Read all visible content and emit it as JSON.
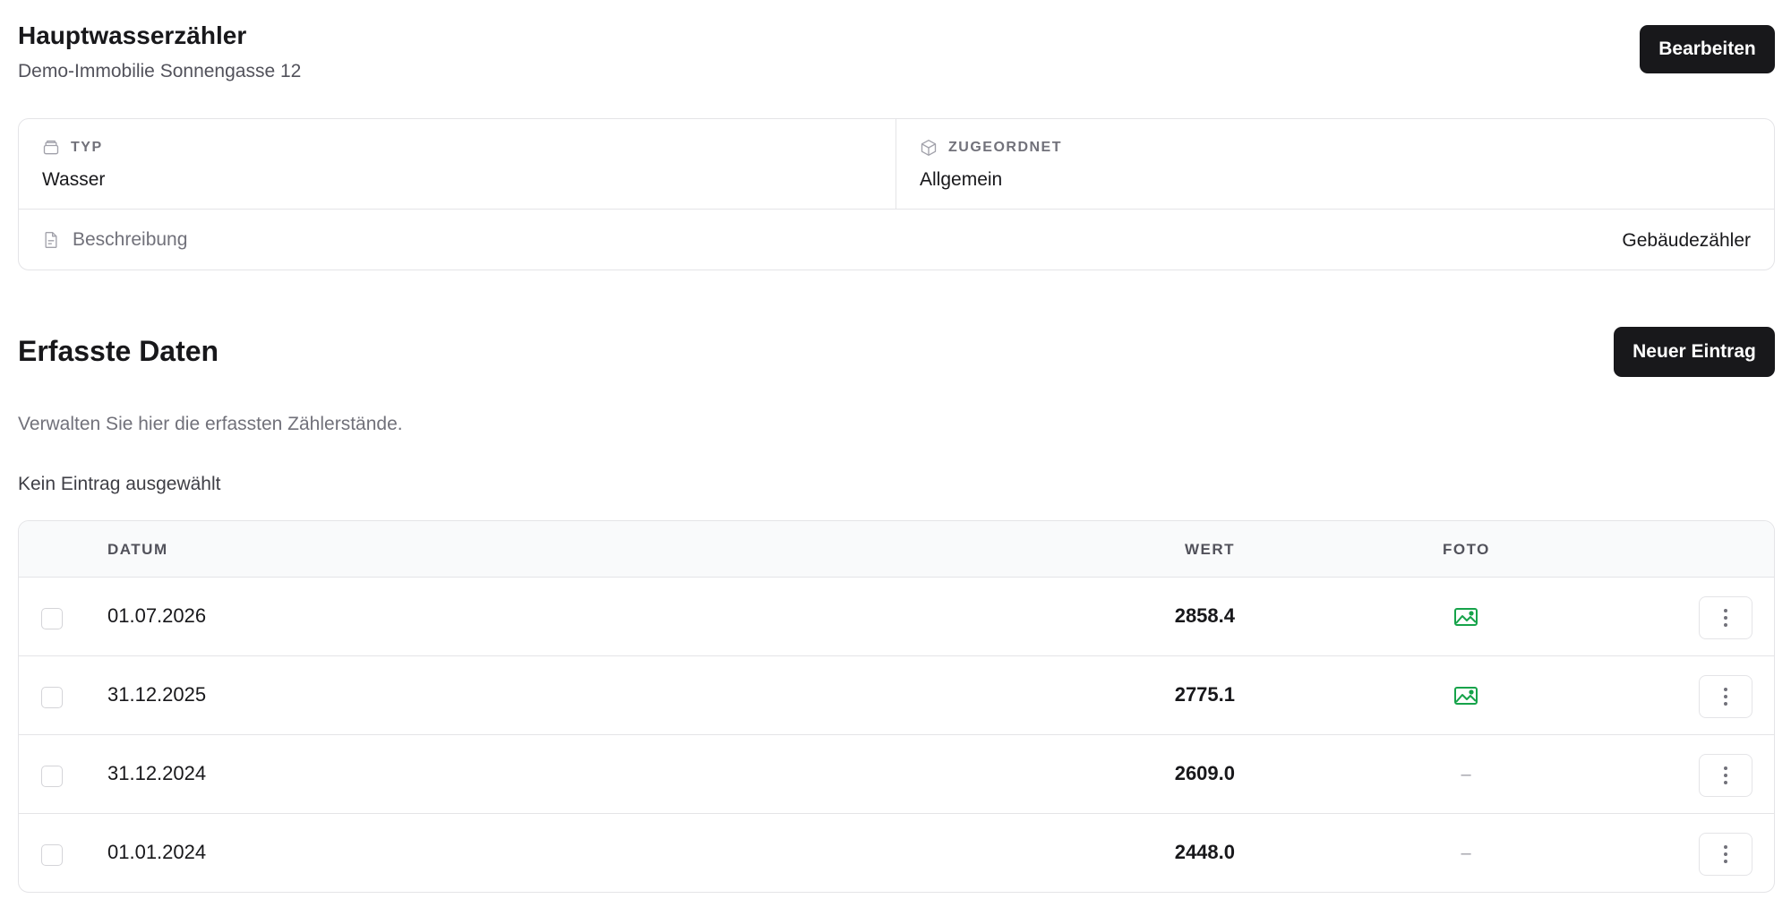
{
  "header": {
    "title": "Hauptwasserzähler",
    "subtitle": "Demo-Immobilie Sonnengasse 12",
    "edit_label": "Bearbeiten"
  },
  "info": {
    "type_label": "TYP",
    "type_value": "Wasser",
    "assigned_label": "ZUGEORDNET",
    "assigned_value": "Allgemein",
    "description_label": "Beschreibung",
    "description_value": "Gebäudezähler"
  },
  "section": {
    "title": "Erfasste Daten",
    "new_label": "Neuer Eintrag",
    "description": "Verwalten Sie hier die erfassten Zählerstände.",
    "selection_info": "Kein Eintrag ausgewählt"
  },
  "table": {
    "columns": {
      "date": "DATUM",
      "value": "WERT",
      "photo": "FOTO"
    },
    "rows": [
      {
        "date": "01.07.2026",
        "value": "2858.4",
        "photo": true,
        "photo_icon": "image-icon"
      },
      {
        "date": "31.12.2025",
        "value": "2775.1",
        "photo": true,
        "photo_icon": "image-icon"
      },
      {
        "date": "31.12.2024",
        "value": "2609.0",
        "photo": false,
        "photo_placeholder": "–"
      },
      {
        "date": "01.01.2024",
        "value": "2448.0",
        "photo": false,
        "photo_placeholder": "–"
      }
    ]
  },
  "colors": {
    "primary_button": "#18181b",
    "photo_icon": "#16a34a",
    "border": "#e4e4e7",
    "muted_text": "#71717a"
  }
}
